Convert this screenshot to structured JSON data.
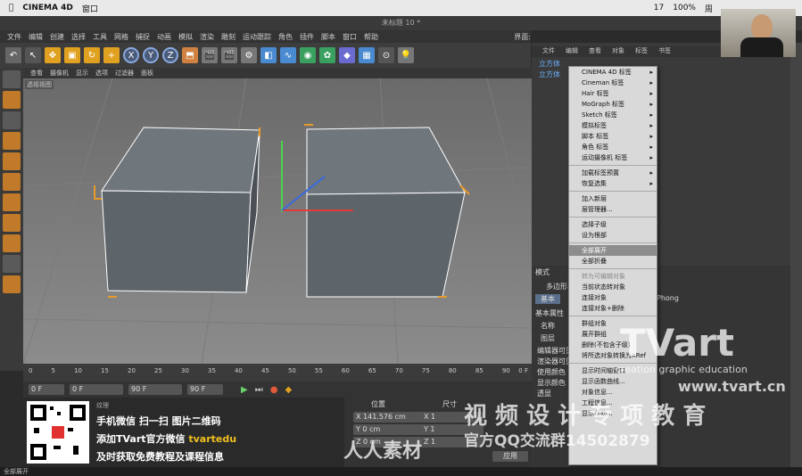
{
  "mac": {
    "app": "CINEMA 4D",
    "menu": "窗口",
    "time": "周",
    "battery": "100%",
    "date": "17"
  },
  "window_title": "未标题 10 *",
  "menubar": [
    "文件",
    "编辑",
    "创建",
    "选择",
    "工具",
    "网格",
    "捕捉",
    "动画",
    "模拟",
    "渲染",
    "雕刻",
    "运动跟踪",
    "角色",
    "插件",
    "脚本",
    "窗口",
    "帮助"
  ],
  "layout_label": "界面:",
  "viewport_menu": [
    "查看",
    "摄像机",
    "显示",
    "选项",
    "过滤器",
    "面板"
  ],
  "viewport_label": "透视视图",
  "timeline": {
    "ticks": [
      "0",
      "5",
      "10",
      "15",
      "20",
      "25",
      "30",
      "35",
      "40",
      "45",
      "50",
      "55",
      "60",
      "65",
      "70",
      "75",
      "80",
      "85",
      "90"
    ],
    "end_label": "0 F"
  },
  "transport": {
    "start": "0 F",
    "current": "0 F",
    "min": "90 F",
    "end": "90 F"
  },
  "promo": {
    "line1": "手机微信 扫一扫 图片二维码",
    "line2_prefix": "添加TVart官方微信",
    "line2_id": "tvartedu",
    "line3": "及时获取免费教程及课程信息",
    "label": "纹理"
  },
  "coords": {
    "header_pos": "位置",
    "header_size": "尺寸",
    "x": "X 141.576 cm",
    "y": "Y 0 cm",
    "z": "Z 0 cm",
    "sx": "X 1",
    "sy": "Y 1",
    "sz": "Z 1",
    "apply": "应用"
  },
  "object_manager_menu": [
    "文件",
    "编辑",
    "查看",
    "对象",
    "标签",
    "书签"
  ],
  "objects": [
    "立方体",
    "立方体"
  ],
  "context_menu": [
    {
      "label": "CINEMA 4D 标签",
      "arrow": true
    },
    {
      "label": "Cineman 标签",
      "arrow": true
    },
    {
      "label": "Hair 标签",
      "arrow": true
    },
    {
      "label": "MoGraph 标签",
      "arrow": true
    },
    {
      "label": "Sketch 标签",
      "arrow": true
    },
    {
      "label": "模拟标签",
      "arrow": true
    },
    {
      "label": "脚本 标签",
      "arrow": true
    },
    {
      "label": "角色 标签",
      "arrow": true
    },
    {
      "label": "运动摄像机 标签",
      "arrow": true
    },
    {
      "label": "加载标签预置",
      "arrow": true,
      "sep_before": true
    },
    {
      "label": "恢复选集",
      "arrow": true
    },
    {
      "label": "加入新层",
      "sep_before": true
    },
    {
      "label": "层管理器..."
    },
    {
      "label": "选择子级",
      "sep_before": true
    },
    {
      "label": "设为根部"
    },
    {
      "label": "全部展开",
      "sep_before": true,
      "highlight": true
    },
    {
      "label": "全部折叠"
    },
    {
      "label": "转为可编辑对象",
      "sep_before": true,
      "disabled": true
    },
    {
      "label": "当前状态转对象"
    },
    {
      "label": "连接对象"
    },
    {
      "label": "连接对象+删除"
    },
    {
      "label": "群组对象",
      "sep_before": true
    },
    {
      "label": "展开群组"
    },
    {
      "label": "删除(不包含子级)"
    },
    {
      "label": "将所选对象转换为XRef"
    },
    {
      "label": "显示时间轴窗口",
      "sep_before": true
    },
    {
      "label": "显示函数曲线..."
    },
    {
      "label": "对象信息..."
    },
    {
      "label": "工程信息..."
    },
    {
      "label": "显示帮助..."
    }
  ],
  "attr": {
    "mode": "模式",
    "polygon_label": "多边形",
    "tab_basic": "基本",
    "section": "基本属性",
    "name": "名称",
    "layer": "图层",
    "editor_visible": "编辑器可见",
    "render_visible": "渲染器可见",
    "use_color": "使用颜色",
    "show_color": "显示颜色",
    "transparent": "透显",
    "phong": "Phong"
  },
  "watermark": {
    "brand": "TVart",
    "edu": "creation graphic education",
    "url": "www.tvart.cn",
    "title": "视 频 设 计 专 项 教 育",
    "qq": "官方QQ交流群14502879",
    "site": "人人素材"
  },
  "status": "全部展开"
}
